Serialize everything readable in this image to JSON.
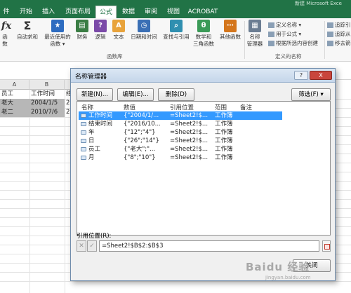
{
  "window": {
    "title_fragment": "新建 Microsoft Exce"
  },
  "ribbon_tabs": [
    "件",
    "开始",
    "插入",
    "页面布局",
    "公式",
    "数据",
    "审阅",
    "视图",
    "ACROBAT"
  ],
  "ribbon": {
    "buttons": {
      "insert_function": "函数",
      "autosum": "自动求和",
      "recent_1": "最近使用的",
      "recent_2": "函数 ▾",
      "financial": "财务",
      "logical": "逻辑",
      "text": "文本",
      "datetime": "日期和时间",
      "lookup": "查找与引用",
      "math_1": "数学和",
      "math_2": "三角函数",
      "more": "其他函数",
      "name_mgr_1": "名称",
      "name_mgr_2": "管理器"
    },
    "small_buttons": {
      "define_name": "定义名称 ▾",
      "use_in_formula": "用于公式 ▾",
      "create_from_selection": "根据所选内容创建",
      "trace_precedents": "追踪引",
      "trace_dependents": "追踪从",
      "remove_arrows": "移去箭"
    },
    "group_labels": {
      "function_library": "函数库",
      "defined_names": "定义的名称"
    }
  },
  "sheet": {
    "col_headers": [
      "A",
      "B"
    ],
    "rows": [
      [
        "员工",
        "工作时间",
        "结"
      ],
      [
        "老大",
        "2004/1/5",
        "2"
      ],
      [
        "老二",
        "2010/7/6",
        "2"
      ]
    ]
  },
  "dialog": {
    "title": "名称管理器",
    "title_buttons": {
      "help": "?",
      "close": "X"
    },
    "buttons": {
      "new": "新建(N)...",
      "edit": "编辑(E)...",
      "delete": "删除(D)",
      "filter": "筛选(F) ▾"
    },
    "columns": [
      "名称",
      "数值",
      "引用位置",
      "范围",
      "备注"
    ],
    "names": [
      {
        "name": "工作时间",
        "value": "{\"2004/1/...",
        "refers_to": "=Sheet2!$...",
        "scope": "工作簿",
        "comment": ""
      },
      {
        "name": "结束时间",
        "value": "{\"2016/10...",
        "refers_to": "=Sheet2!$...",
        "scope": "工作簿",
        "comment": ""
      },
      {
        "name": "年",
        "value": "{\"12\";\"4\"}",
        "refers_to": "=Sheet2!$...",
        "scope": "工作簿",
        "comment": ""
      },
      {
        "name": "日",
        "value": "{\"26\";\"14\"}",
        "refers_to": "=Sheet2!$...",
        "scope": "工作簿",
        "comment": ""
      },
      {
        "name": "员工",
        "value": "{\"老大\";\"...",
        "refers_to": "=Sheet2!$...",
        "scope": "工作簿",
        "comment": ""
      },
      {
        "name": "月",
        "value": "{\"8\";\"10\"}",
        "refers_to": "=Sheet2!$...",
        "scope": "工作簿",
        "comment": ""
      }
    ],
    "selected_index": 0,
    "refers_to_label": "引用位置(R):",
    "refers_to_value": "=Sheet2!$B$2:$B$3",
    "close_button": "关闭"
  },
  "watermark": {
    "big": "Baidu 经验",
    "small": "jingyan.baidu.com"
  }
}
